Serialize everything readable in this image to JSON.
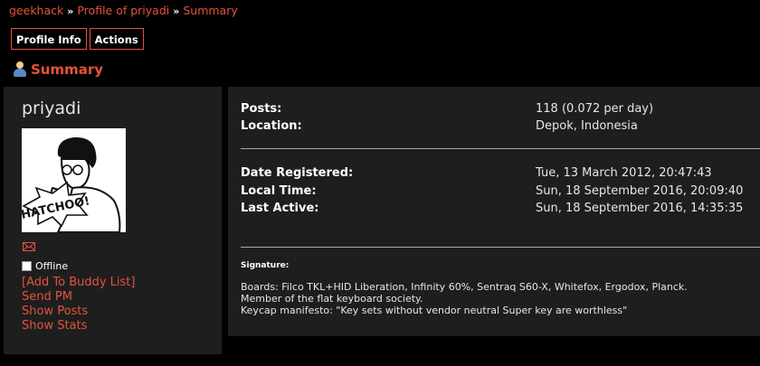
{
  "breadcrumb": {
    "items": [
      "geekhack",
      "Profile of priyadi",
      "Summary"
    ],
    "separator": "»"
  },
  "tabs": [
    "Profile Info",
    "Actions"
  ],
  "summary_heading": {
    "icon": "user-icon",
    "title": "Summary"
  },
  "profile": {
    "username": "priyadi",
    "avatar_text": "HATCHOO!",
    "mail_icon": "envelope-icon",
    "status": "Offline",
    "links": [
      "[Add To Buddy List]",
      "Send PM",
      "Show Posts",
      "Show Stats"
    ]
  },
  "stats": [
    {
      "label": "Posts:",
      "value": "118 (0.072 per day)"
    },
    {
      "label": "Location:",
      "value": "Depok, Indonesia"
    },
    {
      "label": "Date Registered:",
      "value": "Tue, 13 March 2012, 20:47:43"
    },
    {
      "label": "Local Time:",
      "value": "Sun, 18 September 2016, 20:09:40"
    },
    {
      "label": "Last Active:",
      "value": "Sun, 18 September 2016, 14:35:35"
    }
  ],
  "signature": {
    "label": "Signature:",
    "lines": [
      "Boards: Filco TKL+HID Liberation, Infinity 60%, Sentraq S60-X, Whitefox, Ergodox, Planck.",
      "Member of the flat keyboard society.",
      "Keycap manifesto: \"Key sets without vendor neutral Super key are worthless\""
    ]
  },
  "colors": {
    "accent": "#e2543a",
    "panel": "#1e1e1e",
    "background": "#000000"
  }
}
